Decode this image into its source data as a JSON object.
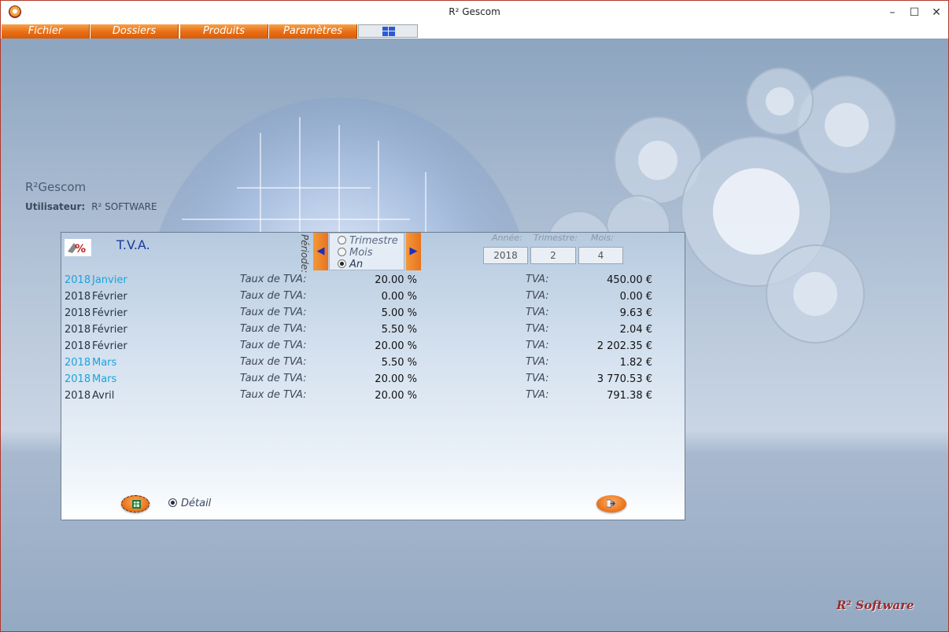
{
  "window": {
    "title": "R² Gescom"
  },
  "menu": {
    "items": [
      "Fichier",
      "Dossiers",
      "Produits",
      "Paramètres"
    ]
  },
  "desktop": {
    "app_name": "R²Gescom",
    "user_label": "Utilisateur:",
    "user_value": "R² SOFTWARE",
    "brand": "R² Software"
  },
  "tva_panel": {
    "title": "T.V.A.",
    "periode_label": "Période:",
    "period_options": [
      "Trimestre",
      "Mois",
      "An"
    ],
    "selected_period": "An",
    "fields": {
      "annee_label": "Année:",
      "annee_value": "2018",
      "trimestre_label": "Trimestre:",
      "trimestre_value": "2",
      "mois_label": "Mois:",
      "mois_value": "4"
    },
    "taux_label": "Taux de TVA:",
    "tva_label": "TVA:",
    "rows": [
      {
        "year": "2018",
        "month": "Janvier",
        "taux": "20.00 %",
        "tva": "450.00 €",
        "highlight": true
      },
      {
        "year": "2018",
        "month": "Février",
        "taux": "0.00 %",
        "tva": "0.00 €",
        "highlight": false
      },
      {
        "year": "2018",
        "month": "Février",
        "taux": "5.00 %",
        "tva": "9.63 €",
        "highlight": false
      },
      {
        "year": "2018",
        "month": "Février",
        "taux": "5.50 %",
        "tva": "2.04 €",
        "highlight": false
      },
      {
        "year": "2018",
        "month": "Février",
        "taux": "20.00 %",
        "tva": "2 202.35 €",
        "highlight": false
      },
      {
        "year": "2018",
        "month": "Mars",
        "taux": "5.50 %",
        "tva": "1.82 €",
        "highlight": true
      },
      {
        "year": "2018",
        "month": "Mars",
        "taux": "20.00 %",
        "tva": "3 770.53 €",
        "highlight": true
      },
      {
        "year": "2018",
        "month": "Avril",
        "taux": "20.00 %",
        "tva": "791.38 €",
        "highlight": false
      }
    ],
    "detail_label": "Détail"
  },
  "colors": {
    "accent_orange": "#e8731e",
    "highlight_blue": "#1aa3db",
    "title_blue": "#1a3a9a"
  }
}
